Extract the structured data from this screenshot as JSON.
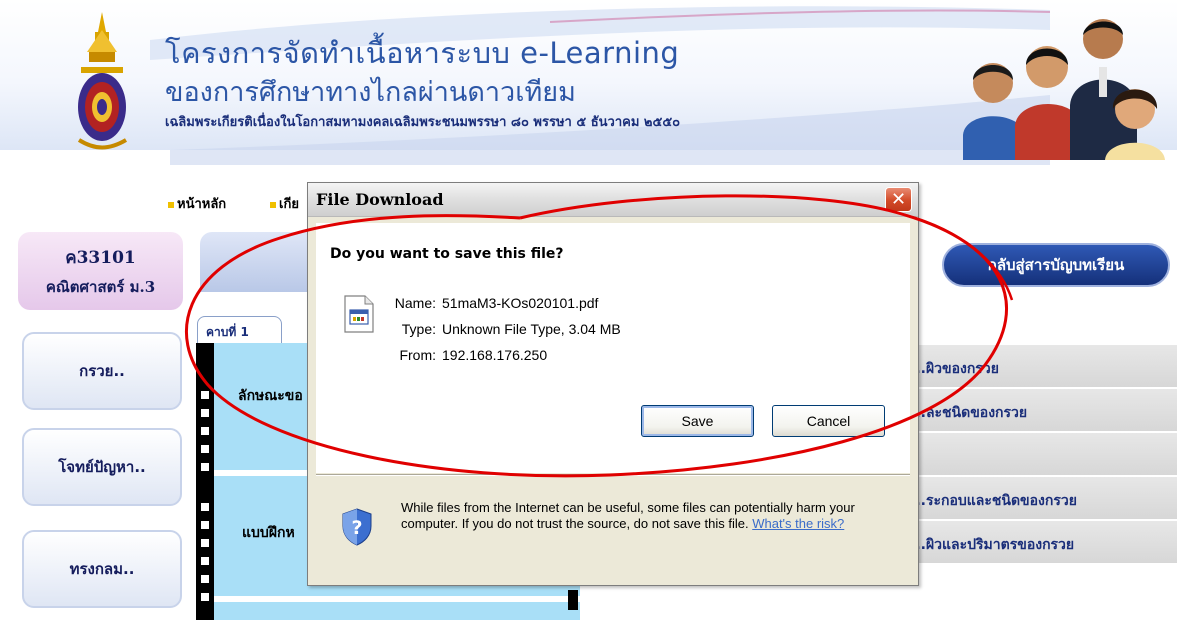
{
  "header": {
    "line1": "โครงการจัดทำเนื้อหาระบบ e-Learning",
    "line2": "ของการศึกษาทางไกลผ่านดาวเทียม",
    "line3": "เฉลิมพระเกียรติเนื่องในโอกาสมหามงคลเฉลิมพระชนมพรรษา ๘๐ พรรษา ๕ ธันวาคม ๒๕๕๐"
  },
  "nav": {
    "home": "หน้าหลัก",
    "second": "เกีย"
  },
  "course": {
    "code": "ค33101",
    "name": "คณิตศาสตร์ ม.3"
  },
  "sidebar": {
    "items": [
      {
        "label": "กรวย.."
      },
      {
        "label": "โจทย์ปัญหา.."
      },
      {
        "label": "ทรงกลม.."
      }
    ]
  },
  "content": {
    "tab": "คาบที่ 1",
    "row1": "ลักษณะขอ",
    "row2": "แบบฝึกห"
  },
  "right_panel": {
    "back_button": "กลับสู่สารบัญบทเรียน",
    "items": [
      "...ผิวของกรวย",
      "...ละชนิดของกรวย",
      "",
      "...ระกอบและชนิดของกรวย",
      "...ผิวและปริมาตรของกรวย"
    ]
  },
  "dialog": {
    "title": "File Download",
    "question": "Do you want to save this file?",
    "name_label": "Name:",
    "name_value": "51maM3-KOs020101.pdf",
    "type_label": "Type:",
    "type_value": "Unknown File Type, 3.04 MB",
    "from_label": "From:",
    "from_value": "192.168.176.250",
    "save": "Save",
    "cancel": "Cancel",
    "warning": "While files from the Internet can be useful, some files can potentially harm your computer. If you do not trust the source, do not save this file.",
    "risk_link": "What's the risk?"
  },
  "colors": {
    "title_blue": "#2c56a6",
    "content_cyan": "#a9dff7",
    "annotation_red": "#e00000"
  }
}
